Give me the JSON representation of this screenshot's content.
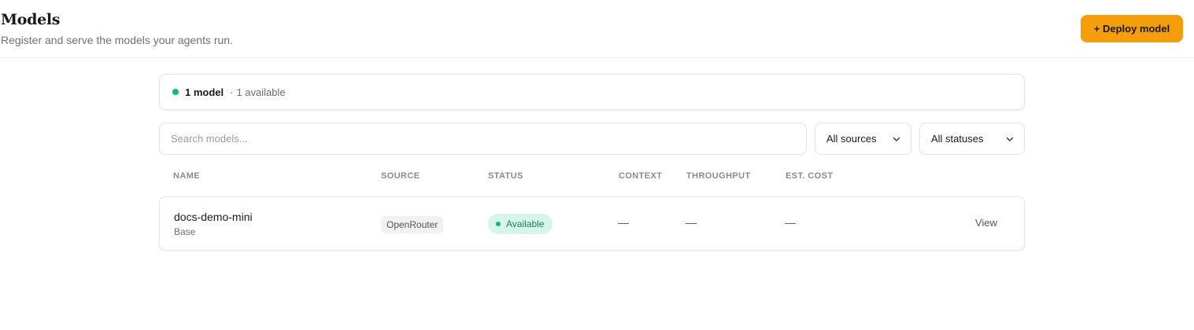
{
  "header": {
    "title": "Models",
    "subtitle": "Register and serve the models your agents run.",
    "deploy_label": "+ Deploy model"
  },
  "summary": {
    "count_label": "1 model",
    "separator": "·",
    "available_label": "1 available"
  },
  "filters": {
    "search_placeholder": "Search models...",
    "source_selected": "All sources",
    "status_selected": "All statuses"
  },
  "table": {
    "columns": [
      "NAME",
      "SOURCE",
      "STATUS",
      "CONTEXT",
      "THROUGHPUT",
      "EST. COST"
    ],
    "rows": [
      {
        "name": "docs-demo-mini",
        "variant": "Base",
        "source": "OpenRouter",
        "status": "Available",
        "context": "—",
        "throughput": "—",
        "cost": "—",
        "action": "View"
      }
    ]
  },
  "colors": {
    "accent": "#f59e0b",
    "status_available": "#10b981",
    "status_badge_bg": "#d8f5ea"
  },
  "icons": {
    "status_dot": "green-dot-icon",
    "select_chevron": "chevron-down-icon"
  }
}
